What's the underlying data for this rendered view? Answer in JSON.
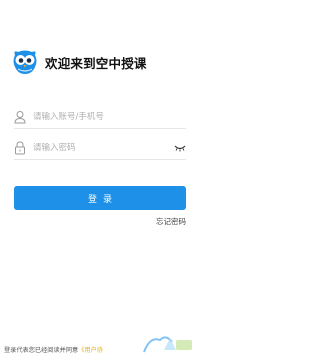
{
  "header": {
    "welcome_text": "欢迎来到空中授课",
    "logo_icon": "owl-icon"
  },
  "form": {
    "account": {
      "placeholder": "请输入账号/手机号",
      "value": "",
      "icon": "user-icon"
    },
    "password": {
      "placeholder": "请输入密码",
      "value": "",
      "icon": "lock-icon",
      "toggle_icon": "eye-closed-icon"
    },
    "login_label": "登录",
    "forgot_label": "忘记密码"
  },
  "footer": {
    "agreement_prefix": "登录代表您已经阅读并同意",
    "agreement_link": "《用户协"
  },
  "colors": {
    "primary": "#1e90e8",
    "link": "#e3b11b"
  }
}
